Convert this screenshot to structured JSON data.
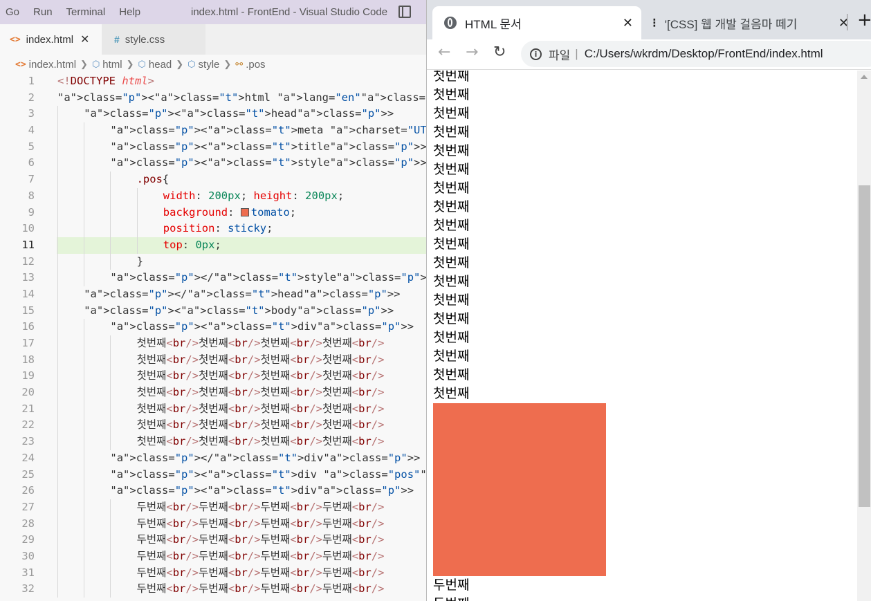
{
  "vscode": {
    "menu": [
      "Go",
      "Run",
      "Terminal",
      "Help"
    ],
    "window_title": "index.html - FrontEnd - Visual Studio Code",
    "tabs": [
      {
        "label": "index.html",
        "icon": "html-file-icon",
        "active": true
      },
      {
        "label": "style.css",
        "icon": "css-file-icon",
        "active": false
      }
    ],
    "breadcrumb": [
      "index.html",
      "html",
      "head",
      "style",
      ".pos"
    ],
    "active_line": 11,
    "code_lines": [
      "<!DOCTYPE html>",
      "<html lang=\"en\">",
      "<head>",
      "<meta charset=\"UTF-8\">",
      "<title>HTML 문서</title>",
      "<style>",
      ".pos{",
      "width: 200px; height: 200px;",
      "background: tomato;",
      "position: sticky;",
      "top: 0px;",
      "}",
      "</style>",
      "</head>",
      "<body>",
      "<div>",
      "첫번째<br/>첫번째<br/>첫번째<br/>첫번째<br/>",
      "첫번째<br/>첫번째<br/>첫번째<br/>첫번째<br/>",
      "첫번째<br/>첫번째<br/>첫번째<br/>첫번째<br/>",
      "첫번째<br/>첫번째<br/>첫번째<br/>첫번째<br/>",
      "첫번째<br/>첫번째<br/>첫번째<br/>첫번째<br/>",
      "첫번째<br/>첫번째<br/>첫번째<br/>첫번째<br/>",
      "첫번째<br/>첫번째<br/>첫번째<br/>첫번째<br/>",
      "</div>",
      "<div class=\"pos\"></div>",
      "<div>",
      "두번째<br/>두번째<br/>두번째<br/>두번째<br/>",
      "두번째<br/>두번째<br/>두번째<br/>두번째<br/>",
      "두번째<br/>두번째<br/>두번째<br/>두번째<br/>",
      "두번째<br/>두번째<br/>두번째<br/>두번째<br/>",
      "두번째<br/>두번째<br/>두번째<br/>두번째<br/>",
      "두번째<br/>두번째<br/>두번째<br/>두번째<br/>"
    ]
  },
  "browser": {
    "tabs": [
      {
        "title": "HTML 문서",
        "active": true
      },
      {
        "title": "'[CSS] 웹 개발 걸음마 떼기",
        "active": false
      }
    ],
    "url_label": "파일",
    "url": "C:/Users/wkrdm/Desktop/FrontEnd/index.html",
    "first_text": "첫번째",
    "first_count": 18,
    "second_text": "두번째",
    "second_count": 2,
    "box_color": "#ee6d4f"
  }
}
